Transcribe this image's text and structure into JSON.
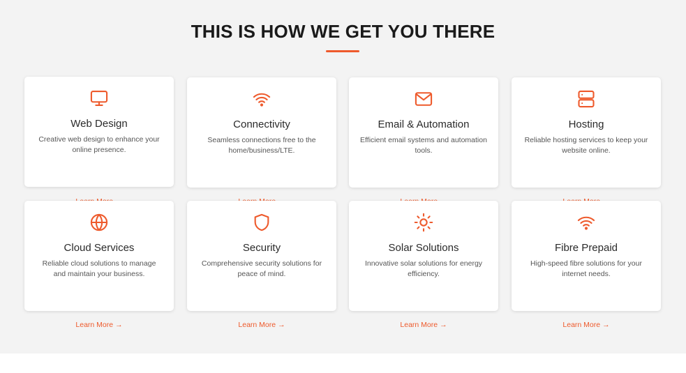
{
  "section": {
    "heading": "THIS IS HOW WE GET YOU THERE"
  },
  "colors": {
    "accent": "#ee5a2c",
    "background": "#f3f3f3",
    "card": "#ffffff"
  },
  "cards": [
    {
      "title": "Web Design",
      "description": "Creative web design to enhance your online presence.",
      "icon": "monitor-icon",
      "link": "Learn More",
      "arrow": "→"
    },
    {
      "title": "Connectivity",
      "description": "Seamless connections free to the home/business/LTE.",
      "icon": "wifi-icon",
      "link": "Learn More",
      "arrow": "→"
    },
    {
      "title": "Email & Automation",
      "description": "Efficient email systems and automation tools.",
      "icon": "mail-icon",
      "link": "Learn More",
      "arrow": "→"
    },
    {
      "title": "Hosting",
      "description": "Reliable hosting services to keep your website online.",
      "icon": "server-icon",
      "link": "Learn More",
      "arrow": "→"
    },
    {
      "title": "Cloud Services",
      "description": "Reliable cloud solutions to manage and maintain your business.",
      "icon": "globe-icon",
      "link": "Learn More",
      "arrow": "→"
    },
    {
      "title": "Security",
      "description": "Comprehensive security solutions for peace of mind.",
      "icon": "shield-icon",
      "link": "Learn More",
      "arrow": "→"
    },
    {
      "title": "Solar Solutions",
      "description": "Innovative solar solutions for energy efficiency.",
      "icon": "sun-icon",
      "link": "Learn More",
      "arrow": "→"
    },
    {
      "title": "Fibre Prepaid",
      "description": "High-speed fibre solutions for your internet needs.",
      "icon": "wifi-icon",
      "link": "Learn More",
      "arrow": "→"
    }
  ]
}
